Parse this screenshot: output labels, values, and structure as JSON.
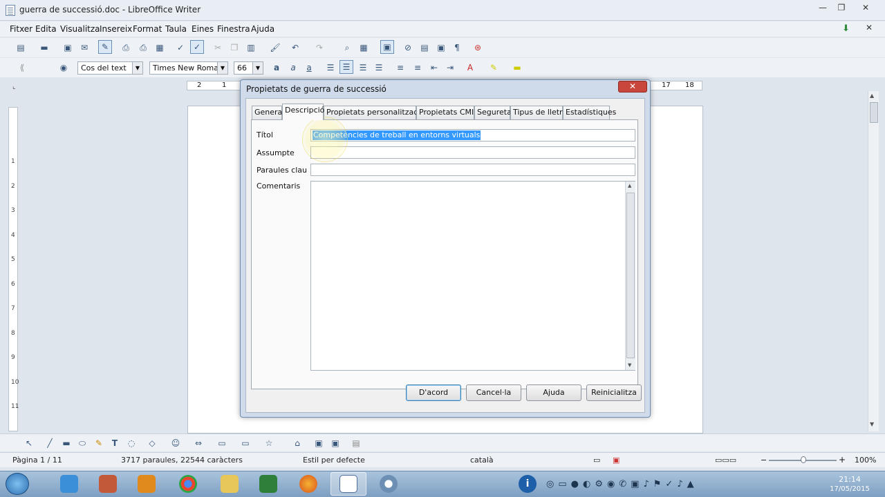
{
  "window": {
    "title": "guerra de successió.doc - LibreOffice Writer",
    "controls": {
      "minimize": "—",
      "maximize": "❐",
      "close": "✕"
    }
  },
  "menubar": [
    "Fitxer",
    "Edita",
    "Visualitza",
    "Insereix",
    "Format",
    "Taula",
    "Eines",
    "Finestra",
    "Ajuda"
  ],
  "formatting": {
    "paragraph_style": "Cos del text",
    "font_name": "Times New Roman",
    "font_size": "66"
  },
  "ruler": {
    "left_ticks": [
      "2",
      "1"
    ],
    "right_ticks": [
      "17",
      "18"
    ],
    "vertical_ticks": [
      "1",
      "2",
      "3",
      "4",
      "5",
      "6",
      "7",
      "8",
      "9",
      "10",
      "11"
    ]
  },
  "dialog": {
    "title": "Propietats de guerra de successió",
    "tabs": [
      "General",
      "Descripció",
      "Propietats personalitzades",
      "Propietats CMIS",
      "Seguretat",
      "Tipus de lletra",
      "Estadístiques"
    ],
    "active_tab": "Descripció",
    "fields": {
      "title_label": "Títol",
      "title_value": "Competències de treball en entorns virtuals",
      "subject_label": "Assumpte",
      "subject_value": "",
      "keywords_label": "Paraules clau",
      "keywords_value": "",
      "comments_label": "Comentaris",
      "comments_value": ""
    },
    "buttons": {
      "ok": "D'acord",
      "cancel": "Cancel·la",
      "help": "Ajuda",
      "reset": "Reinicialitza"
    }
  },
  "statusbar": {
    "page": "Pàgina 1 / 11",
    "words": "3717 paraules, 22544 caràcters",
    "style": "Estil per defecte",
    "language": "català",
    "zoom": "100%"
  },
  "taskbar": {
    "time": "21:14",
    "date": "17/05/2015"
  },
  "colors": {
    "selection": "#3399ff",
    "close_red": "#c9463d",
    "taskbar": "#8fb0d2"
  }
}
